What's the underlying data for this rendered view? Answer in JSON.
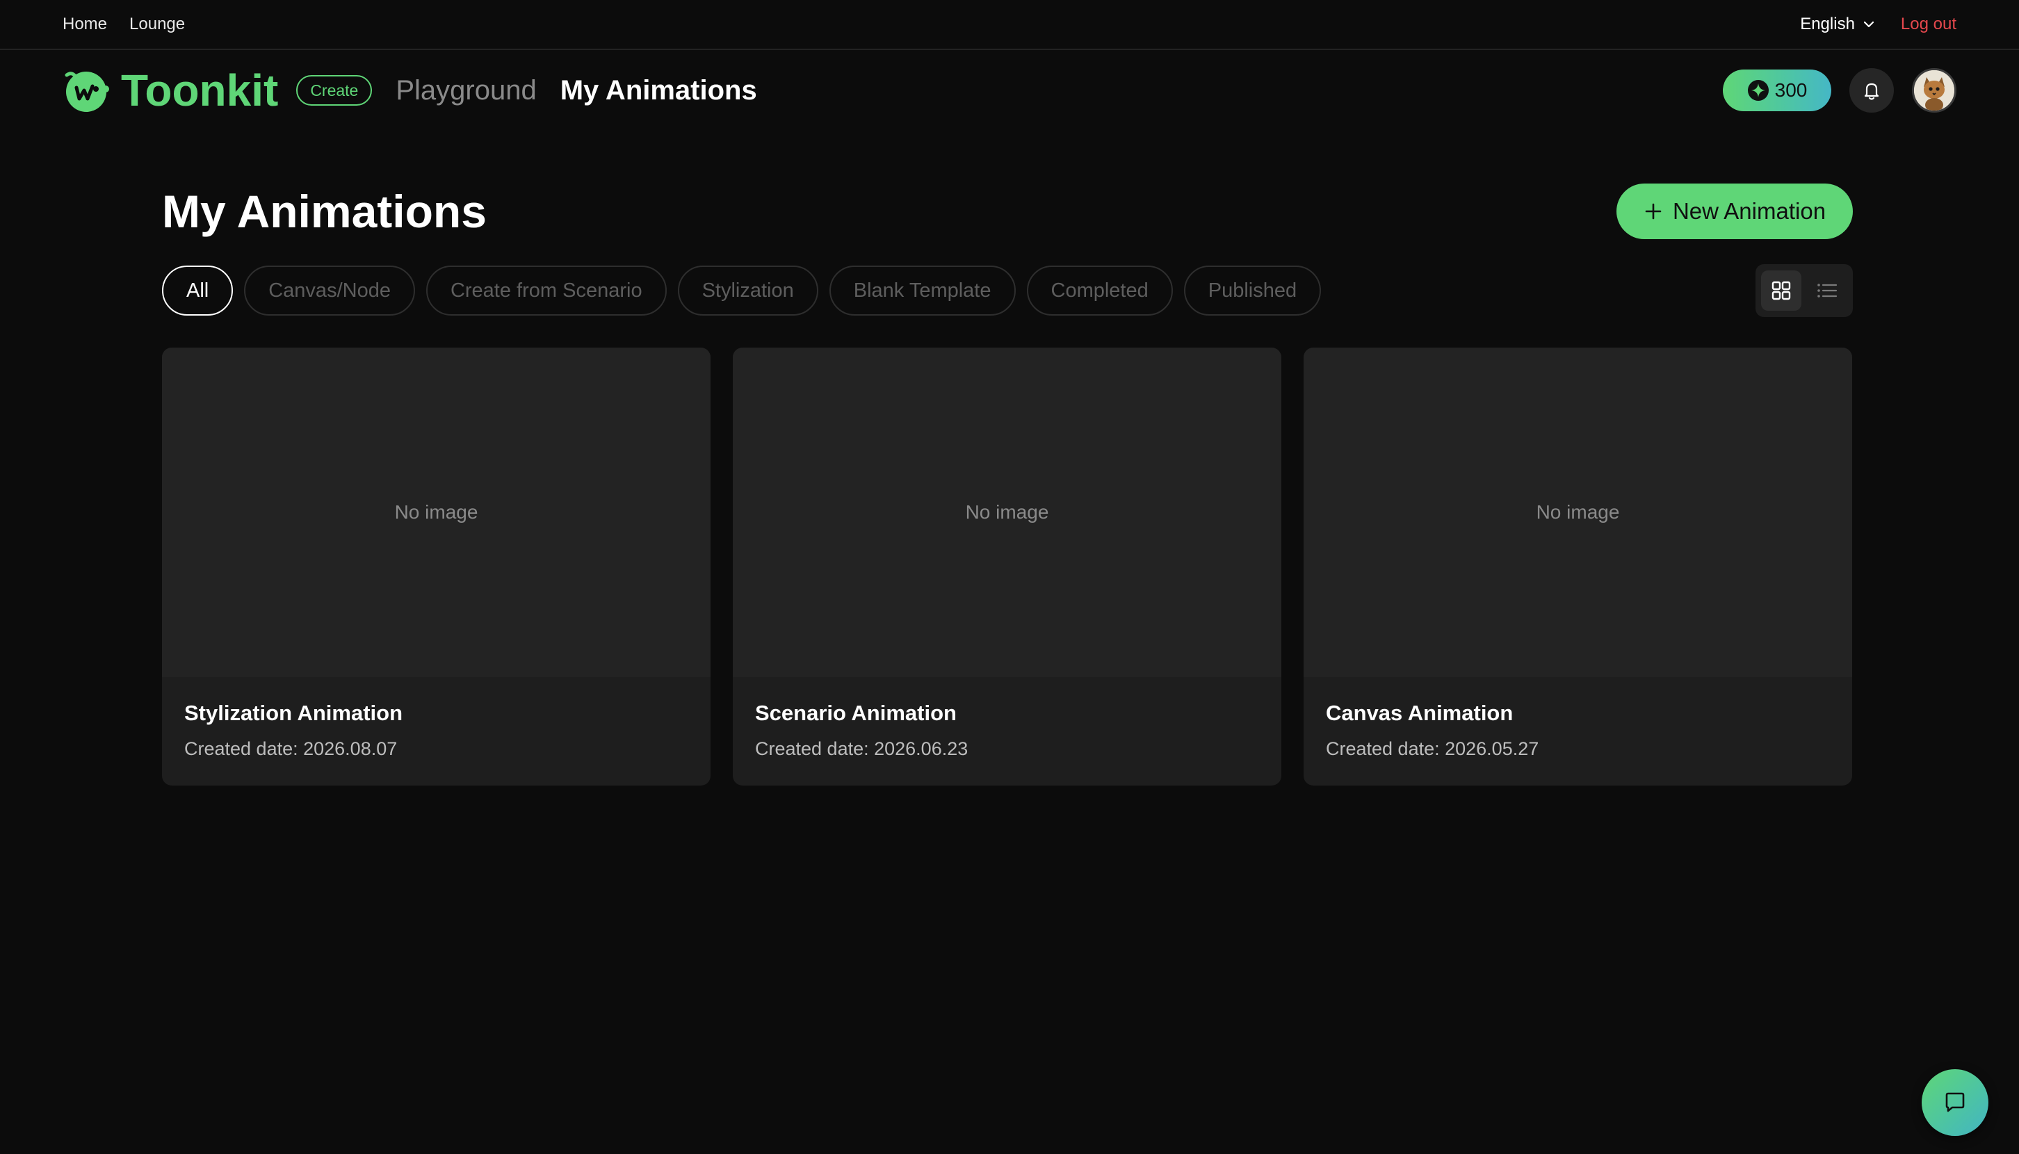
{
  "topbar": {
    "links": [
      {
        "label": "Home"
      },
      {
        "label": "Lounge"
      }
    ],
    "language": "English",
    "logout": "Log out",
    "colors": {
      "logout": "#e5484d"
    }
  },
  "header": {
    "brand": "Toonkit",
    "create_badge": "Create",
    "nav": [
      {
        "label": "Playground"
      },
      {
        "label": "My Animations"
      }
    ],
    "credits": "300",
    "icons": {
      "credit": "sparkle-icon",
      "notifications": "bell-icon",
      "avatar": "avatar-image"
    }
  },
  "main": {
    "title": "My Animations",
    "new_button": "New Animation",
    "filters": [
      {
        "label": "All",
        "active": true
      },
      {
        "label": "Canvas/Node"
      },
      {
        "label": "Create from Scenario"
      },
      {
        "label": "Stylization"
      },
      {
        "label": "Blank Template"
      },
      {
        "label": "Completed"
      },
      {
        "label": "Published"
      }
    ],
    "view_mode": "grid",
    "cards": [
      {
        "thumbnail": "No image",
        "title": "Stylization Animation",
        "date": "Created date: 2026.08.07"
      },
      {
        "thumbnail": "No image",
        "title": "Scenario Animation",
        "date": "Created date: 2026.06.23"
      },
      {
        "thumbnail": "No image",
        "title": "Canvas Animation",
        "date": "Created date: 2026.05.27"
      }
    ]
  },
  "theme": {
    "accent": "#5fd677",
    "background": "#0c0c0c",
    "card": "#1e1e1e"
  },
  "chat": {
    "icon": "chat-bubble-icon"
  }
}
